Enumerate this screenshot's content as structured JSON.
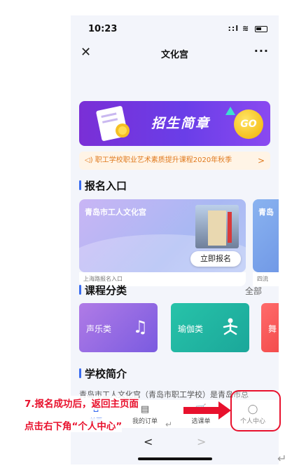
{
  "status": {
    "time": "10:23",
    "signal": "::l"
  },
  "nav": {
    "close": "✕",
    "title": "文化宫",
    "more": "···"
  },
  "banner": {
    "text": "招生简章",
    "go": "GO"
  },
  "notice": {
    "text": "◁) 职工学校职业艺术素质提升课程2020年秋季",
    "chevron": ">"
  },
  "registration": {
    "title": "报名入口",
    "card": {
      "title": "青岛市工人文化宫",
      "button": "立即报名",
      "footer": "上海路报名入口"
    },
    "card2": {
      "title": "青岛",
      "footer": "四流"
    }
  },
  "categories": {
    "title": "课程分类",
    "more": "全部",
    "items": [
      {
        "label": "声乐类",
        "icon": "♫"
      },
      {
        "label": "瑜伽类",
        "icon": "🧘"
      },
      {
        "label": "舞",
        "icon": ""
      }
    ]
  },
  "intro": {
    "title": "学校简介",
    "text": "青岛市工人文化宫（青岛市职工学校）是青岛市总"
  },
  "tabbar": {
    "home": "首页",
    "orders": "我的订单",
    "cart": "选课单",
    "profile": "个人中心"
  },
  "annotation": {
    "line1": "7.报名成功后，返回主页面",
    "line2": "点击右下角“个人中心”"
  },
  "bottom": {
    "back": "<",
    "forward": ">",
    "return_mark": "↵"
  }
}
